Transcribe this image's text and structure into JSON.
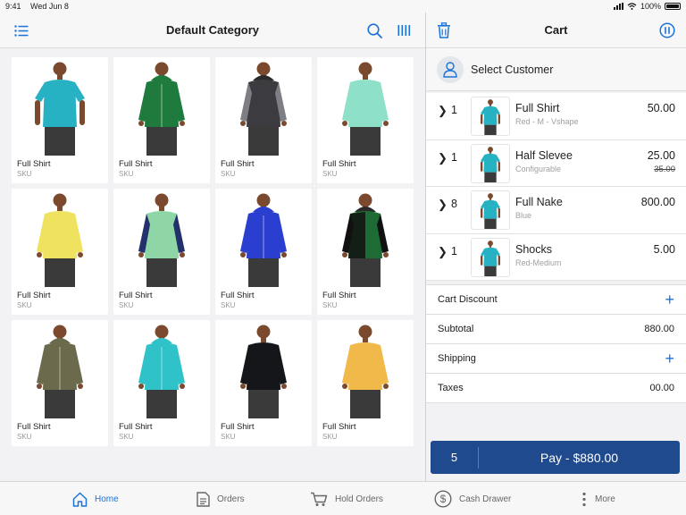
{
  "status_bar": {
    "time": "9:41",
    "date": "Wed Jun 8",
    "battery": "100%"
  },
  "left": {
    "title": "Default Category",
    "products": [
      {
        "name": "Full Shirt",
        "sku": "SKU",
        "color": "#27b2c4",
        "style": "tee"
      },
      {
        "name": "Full Shirt",
        "sku": "SKU",
        "color": "#1f7a3e",
        "style": "hoodie"
      },
      {
        "name": "Full Shirt",
        "sku": "SKU",
        "color": "#3c3c40",
        "style": "hoodie-sleeve"
      },
      {
        "name": "Full Shirt",
        "sku": "SKU",
        "color": "#8fe0c8",
        "style": "long"
      },
      {
        "name": "Full Shirt",
        "sku": "SKU",
        "color": "#eee25e",
        "style": "long"
      },
      {
        "name": "Full Shirt",
        "sku": "SKU",
        "color": "#8ed6a6",
        "style": "raglan"
      },
      {
        "name": "Full Shirt",
        "sku": "SKU",
        "color": "#2a3fcf",
        "style": "hoodie"
      },
      {
        "name": "Full Shirt",
        "sku": "SKU",
        "color": "#1d6b35",
        "style": "hoodie-dark"
      },
      {
        "name": "Full Shirt",
        "sku": "SKU",
        "color": "#6b6a4d",
        "style": "hoodie"
      },
      {
        "name": "Full Shirt",
        "sku": "SKU",
        "color": "#2fc3c9",
        "style": "hoodie"
      },
      {
        "name": "Full Shirt",
        "sku": "SKU",
        "color": "#15161a",
        "style": "long"
      },
      {
        "name": "Full Shirt",
        "sku": "SKU",
        "color": "#f1b84a",
        "style": "long"
      }
    ]
  },
  "cart": {
    "title": "Cart",
    "select_customer": "Select Customer",
    "items": [
      {
        "qty": "1",
        "name": "Full Shirt",
        "variant": "Red - M - Vshape",
        "price": "50.00",
        "old_price": ""
      },
      {
        "qty": "1",
        "name": "Half Slevee",
        "variant": "Configurable",
        "price": "25.00",
        "old_price": "35.00"
      },
      {
        "qty": "8",
        "name": "Full Nake",
        "variant": "Blue",
        "price": "800.00",
        "old_price": ""
      },
      {
        "qty": "1",
        "name": "Shocks",
        "variant": "Red-Medium",
        "price": "5.00",
        "old_price": ""
      }
    ],
    "discount_label": "Cart Discount",
    "subtotal_label": "Subtotal",
    "subtotal_value": "880.00",
    "shipping_label": "Shipping",
    "taxes_label": "Taxes",
    "taxes_value": "00.00",
    "pay_count": "5",
    "pay_label": "Pay - $880.00"
  },
  "tabs": [
    {
      "label": "Home",
      "icon": "home-icon",
      "active": true
    },
    {
      "label": "Orders",
      "icon": "document-icon",
      "active": false
    },
    {
      "label": "Hold Orders",
      "icon": "cart-icon",
      "active": false
    },
    {
      "label": "Cash Drawer",
      "icon": "dollar-icon",
      "active": false
    },
    {
      "label": "More",
      "icon": "more-icon",
      "active": false
    }
  ],
  "colors": {
    "accent": "#1a73d9",
    "pay_button": "#1f4b8e",
    "background": "#f2f2f4"
  }
}
